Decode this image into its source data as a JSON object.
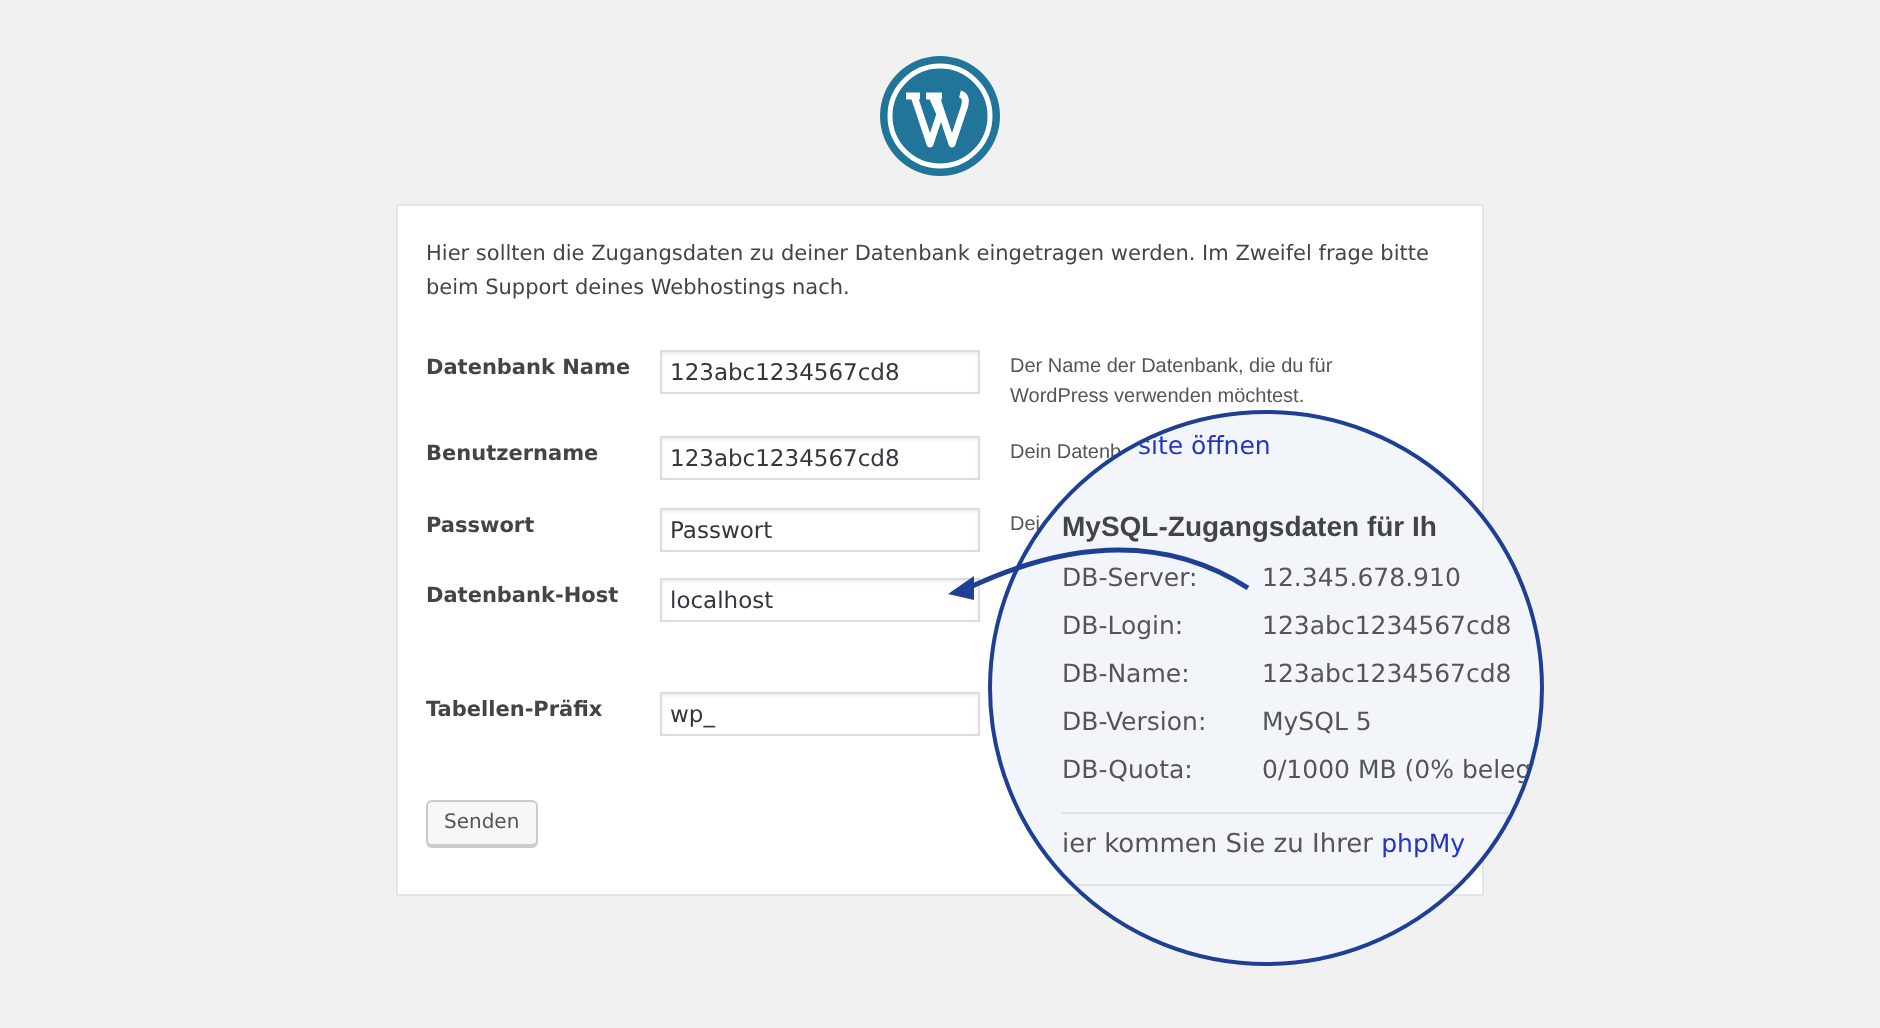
{
  "intro": "Hier sollten die Zugangsdaten zu deiner Datenbank eingetragen werden. Im Zweifel frage bitte beim Support deines Webhostings nach.",
  "fields": [
    {
      "label": "Datenbank Name",
      "value": "123abc1234567cd8",
      "description": "Der Name der Datenbank, die du für WordPress verwenden möchtest."
    },
    {
      "label": "Benutzername",
      "value": "123abc1234567cd8",
      "description": "Dein Datenb"
    },
    {
      "label": "Passwort",
      "value": "Passwort",
      "description": "Dei"
    },
    {
      "label": "Datenbank-Host",
      "value": "localhost"
    },
    {
      "label": "Tabellen-Präfix",
      "value": "wp_"
    }
  ],
  "submit": "Senden",
  "magnifier": {
    "link": "site öffnen",
    "heading": "MySQL-Zugangsdaten für Ih",
    "rows": [
      {
        "label": "DB-Server:",
        "value": "12.345.678.910"
      },
      {
        "label": "DB-Login:",
        "value": "123abc1234567cd8"
      },
      {
        "label": "DB-Name:",
        "value": "123abc1234567cd8"
      },
      {
        "label": "DB-Version:",
        "value": "MySQL 5"
      },
      {
        "label": "DB-Quota:",
        "value": "0/1000 MB (0% beleg"
      }
    ],
    "footer_text": "ier kommen Sie zu Ihrer",
    "footer_link": "phpMy"
  }
}
